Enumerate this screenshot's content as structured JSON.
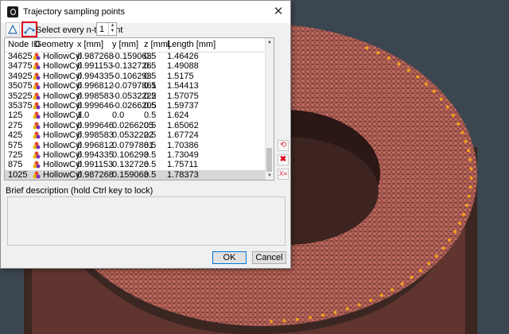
{
  "dialog": {
    "title": "Trajectory sampling points",
    "close_label": "✕",
    "toolbar": {
      "step_label": "Select every n-th point",
      "step_value": "1"
    },
    "columns": [
      "Node ID",
      "Geometry",
      "x [mm]",
      "y [mm]",
      "z [mm]",
      "Length [mm]"
    ],
    "rows": [
      {
        "node": "34625",
        "geometry": "HollowCyl",
        "x": "0.987268",
        "y": "-0.159063",
        "z": "0.5",
        "length": "1.46426"
      },
      {
        "node": "34775",
        "geometry": "HollowCyl",
        "x": "0.991153",
        "y": "-0.132726",
        "z": "0.5",
        "length": "1.49088"
      },
      {
        "node": "34925",
        "geometry": "HollowCyl",
        "x": "0.994335",
        "y": "-0.106293",
        "z": "0.5",
        "length": "1.5175"
      },
      {
        "node": "35075",
        "geometry": "HollowCyl",
        "x": "0.996812",
        "y": "-0.0797861",
        "z": "0.5",
        "length": "1.54413"
      },
      {
        "node": "35225",
        "geometry": "HollowCyl",
        "x": "0.998583",
        "y": "-0.0532222",
        "z": "0.5",
        "length": "1.57075"
      },
      {
        "node": "35375",
        "geometry": "HollowCyl",
        "x": "0.999646",
        "y": "-0.0266205",
        "z": "0.5",
        "length": "1.59737"
      },
      {
        "node": "125",
        "geometry": "HollowCyl",
        "x": "1.0",
        "y": "0.0",
        "z": "0.5",
        "length": "1.624"
      },
      {
        "node": "275",
        "geometry": "HollowCyl",
        "x": "0.999646",
        "y": "0.0266205",
        "z": "0.5",
        "length": "1.65062"
      },
      {
        "node": "425",
        "geometry": "HollowCyl",
        "x": "0.998583",
        "y": "0.0532222",
        "z": "0.5",
        "length": "1.67724"
      },
      {
        "node": "575",
        "geometry": "HollowCyl",
        "x": "0.996812",
        "y": "0.0797861",
        "z": "0.5",
        "length": "1.70386"
      },
      {
        "node": "725",
        "geometry": "HollowCyl",
        "x": "0.994335",
        "y": "0.106293",
        "z": "0.5",
        "length": "1.73049"
      },
      {
        "node": "875",
        "geometry": "HollowCyl",
        "x": "0.991153",
        "y": "0.132726",
        "z": "0.5",
        "length": "1.75711"
      },
      {
        "node": "1025",
        "geometry": "HollowCyl",
        "x": "0.987268",
        "y": "0.159063",
        "z": "0.5",
        "length": "1.78373",
        "selected": true
      }
    ],
    "description_label": "Brief description (hold Ctrl key to lock)",
    "ok_label": "OK",
    "cancel_label": "Cancel",
    "icons": [
      "app-icon",
      "triangle-tool-icon",
      "pick-points-icon",
      "undo-icon",
      "delete-icon",
      "clear-icon",
      "geometry-icon"
    ]
  },
  "colors": {
    "mesh": "#c06a5f",
    "mesh_lines": "#3a1c18",
    "points": "#f2a11a",
    "background": "#3c4650",
    "highlight": "#e0001b",
    "selected_row": "#d6d6d6"
  }
}
